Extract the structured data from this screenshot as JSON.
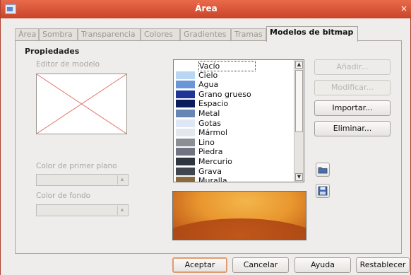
{
  "window": {
    "title": "Área"
  },
  "tabs": [
    {
      "label": "Área",
      "active": false
    },
    {
      "label": "Sombra",
      "active": false
    },
    {
      "label": "Transparencia",
      "active": false
    },
    {
      "label": "Colores",
      "active": false
    },
    {
      "label": "Gradientes",
      "active": false
    },
    {
      "label": "Tramas",
      "active": false
    },
    {
      "label": "Modelos de bitmap",
      "active": true
    }
  ],
  "properties": {
    "heading": "Propiedades",
    "pattern_editor_label": "Editor de modelo",
    "foreground_color_label": "Color de primer plano",
    "foreground_color_value": "",
    "background_color_label": "Color de fondo",
    "background_color_value": ""
  },
  "bitmap_list": {
    "selected": "Vacío",
    "items": [
      {
        "label": "Vacío",
        "swatch": "#ffffff"
      },
      {
        "label": "Cielo",
        "swatch": "#b9d6f3"
      },
      {
        "label": "Agua",
        "swatch": "#6a95d8"
      },
      {
        "label": "Grano grueso",
        "swatch": "#1e3596"
      },
      {
        "label": "Espacio",
        "swatch": "#0b1c5a"
      },
      {
        "label": "Metal",
        "swatch": "#6686b5"
      },
      {
        "label": "Gotas",
        "swatch": "#dfe7f4"
      },
      {
        "label": "Mármol",
        "swatch": "#e3e7ee"
      },
      {
        "label": "Lino",
        "swatch": "#8a8f96"
      },
      {
        "label": "Piedra",
        "swatch": "#6f7480"
      },
      {
        "label": "Mercurio",
        "swatch": "#2f3640"
      },
      {
        "label": "Grava",
        "swatch": "#3f4650"
      },
      {
        "label": "Muralla",
        "swatch": "#8a6a3c"
      }
    ]
  },
  "side_buttons": {
    "add": "Añadir...",
    "modify": "Modificar...",
    "import": "Importar...",
    "delete": "Eliminar..."
  },
  "footer": {
    "ok": "Aceptar",
    "cancel": "Cancelar",
    "help": "Ayuda",
    "reset": "Restablecer"
  },
  "colors": {
    "titlebar": "#d9553a",
    "default_button_border": "#e39a6f"
  }
}
